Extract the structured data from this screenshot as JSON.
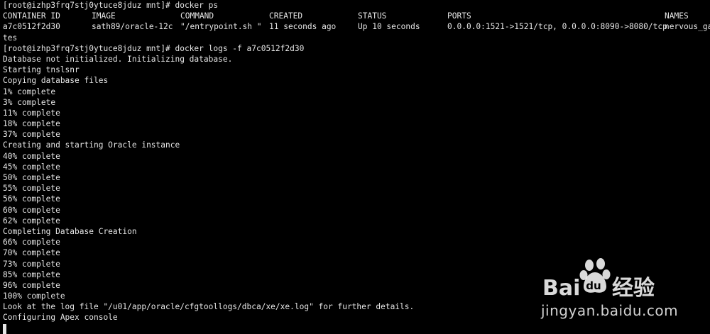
{
  "terminal": {
    "prompt_1": "[root@izhp3frq7stj0ytuce8jduz mnt]# docker ps",
    "ps_headers": [
      "CONTAINER ID",
      "IMAGE",
      "COMMAND",
      "CREATED",
      "STATUS",
      "PORTS",
      "NAMES"
    ],
    "ps_row": [
      "a7c0512f2d30",
      "sath89/oracle-12c",
      "\"/entrypoint.sh \"",
      "11 seconds ago",
      "Up 10 seconds",
      "0.0.0.0:1521->1521/tcp, 0.0.0.0:8090->8080/tcp",
      "nervous_ga"
    ],
    "ps_row_wrap": "tes",
    "prompt_2": "[root@izhp3frq7stj0ytuce8jduz mnt]# docker logs -f a7c0512f2d30",
    "log_lines": [
      "Database not initialized. Initializing database.",
      "Starting tnslsnr",
      "Copying database files",
      "1% complete",
      "3% complete",
      "11% complete",
      "18% complete",
      "37% complete",
      "Creating and starting Oracle instance",
      "40% complete",
      "45% complete",
      "50% complete",
      "55% complete",
      "56% complete",
      "60% complete",
      "62% complete",
      "Completing Database Creation",
      "66% complete",
      "70% complete",
      "73% complete",
      "85% complete",
      "96% complete",
      "100% complete",
      "Look at the log file \"/u01/app/oracle/cfgtoollogs/dbca/xe/xe.log\" for further details.",
      "Configuring Apex console"
    ]
  },
  "watermark": {
    "logo_text": "Bai经验",
    "url": "jingyan.baidu.com"
  },
  "colors": {
    "background": "#000000",
    "foreground": "#e6e6e6"
  }
}
